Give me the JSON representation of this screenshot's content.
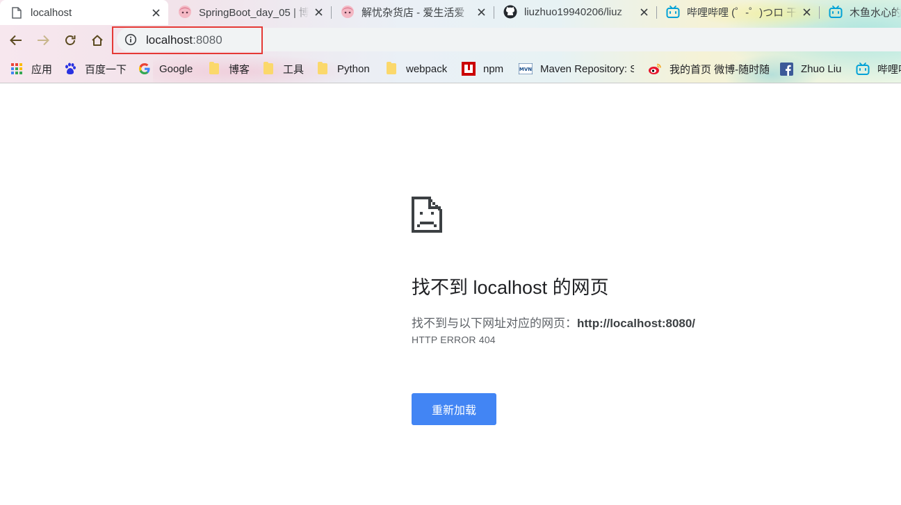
{
  "tabs": [
    {
      "title": "localhost",
      "icon": "page-icon",
      "active": true
    },
    {
      "title": "SpringBoot_day_05 | 博",
      "icon": "anime-avatar-icon",
      "active": false
    },
    {
      "title": "解忧杂货店 - 爱生活爱",
      "icon": "anime-avatar-icon",
      "active": false
    },
    {
      "title": "liuzhuo19940206/liuz",
      "icon": "github-icon",
      "active": false
    },
    {
      "title": "哔哩哔哩 (゜-゜)つロ 干",
      "icon": "bilibili-icon",
      "active": false
    },
    {
      "title": "木鱼水心的",
      "icon": "bilibili-icon",
      "active": false
    }
  ],
  "toolbar": {
    "back_icon": "arrow-back-icon",
    "forward_icon": "arrow-forward-icon",
    "reload_icon": "reload-icon",
    "home_icon": "home-icon",
    "omnibox": {
      "info_icon": "info-icon",
      "host": "localhost",
      "port": ":8080"
    }
  },
  "bookmarks": [
    {
      "label": "应用",
      "icon": "apps-grid-icon"
    },
    {
      "label": "百度一下",
      "icon": "baidu-paw-icon"
    },
    {
      "label": "Google",
      "icon": "google-g-icon"
    },
    {
      "label": "博客",
      "icon": "folder-icon"
    },
    {
      "label": "工具",
      "icon": "folder-icon"
    },
    {
      "label": "Python",
      "icon": "folder-icon"
    },
    {
      "label": "webpack",
      "icon": "folder-icon"
    },
    {
      "label": "npm",
      "icon": "npm-icon"
    },
    {
      "label": "Maven Repository: S",
      "icon": "maven-icon"
    },
    {
      "label": "我的首页 微博-随时随",
      "icon": "weibo-icon"
    },
    {
      "label": "Zhuo Liu",
      "icon": "facebook-icon"
    },
    {
      "label": "哔哩哔",
      "icon": "bilibili-icon"
    }
  ],
  "error_page": {
    "icon": "sad-page-icon",
    "heading": "找不到 localhost 的网页",
    "detail_prefix": "找不到与以下网址对应的网页：",
    "detail_url": "http://localhost:8080/",
    "error_code": "HTTP ERROR 404",
    "reload_label": "重新加载"
  },
  "colors": {
    "accent": "#4285f4",
    "highlight": "#e53935"
  }
}
